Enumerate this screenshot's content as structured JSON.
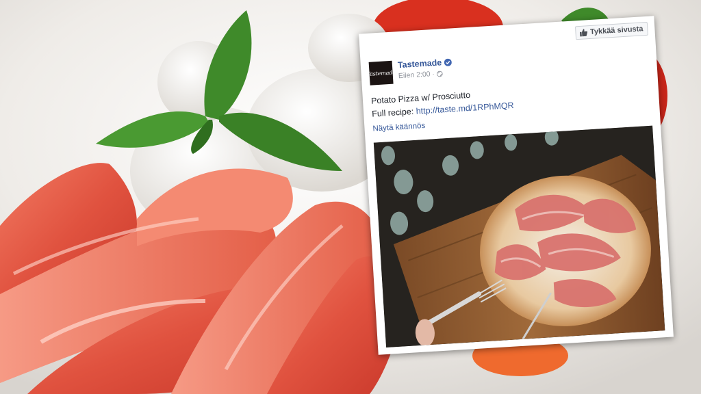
{
  "background": {
    "description_icon": "prosciutto-mozzarella-photo"
  },
  "post": {
    "like_page_label": "Tykkää sivusta",
    "page_name": "Tastemade",
    "avatar_text": "Tastemade",
    "timestamp": "Eilen 2:00",
    "audience_icon": "globe-icon",
    "title_line": "Potato Pizza w/ Prosciutto",
    "recipe_prefix": "Full recipe: ",
    "recipe_link": "http://taste.md/1RPhMQR",
    "see_translation": "Näytä käännös",
    "photo_icon": "potato-pizza-photo"
  },
  "colors": {
    "link": "#365899",
    "text": "#1d2129",
    "meta": "#90949c",
    "verified": "#4267b2"
  }
}
